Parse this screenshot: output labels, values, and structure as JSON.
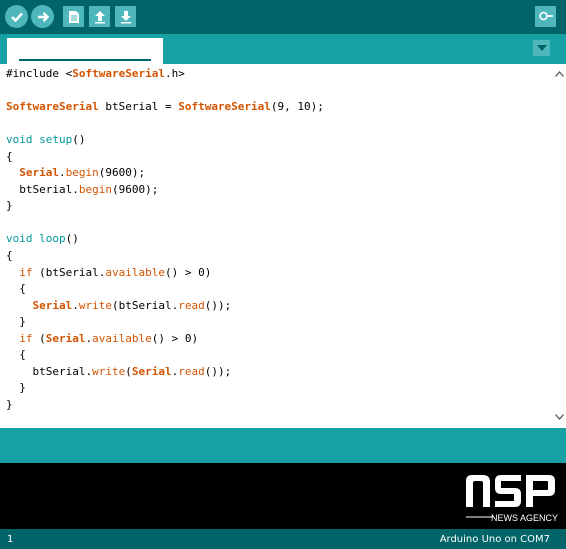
{
  "toolbar": {
    "buttons": [
      {
        "name": "verify",
        "icon": "checkmark-icon"
      },
      {
        "name": "upload",
        "icon": "arrow-right-icon"
      },
      {
        "name": "new",
        "icon": "new-file-icon"
      },
      {
        "name": "open",
        "icon": "arrow-up-icon"
      },
      {
        "name": "save",
        "icon": "arrow-down-icon"
      },
      {
        "name": "serial-monitor",
        "icon": "magnifier-icon"
      }
    ]
  },
  "tab": {
    "label": ""
  },
  "code": {
    "lines": [
      [
        {
          "t": "#include <"
        },
        {
          "t": "SoftwareSerial",
          "c": "class"
        },
        {
          "t": ".h>"
        }
      ],
      [],
      [
        {
          "t": "SoftwareSerial",
          "c": "class"
        },
        {
          "t": " btSerial = "
        },
        {
          "t": "SoftwareSerial",
          "c": "class"
        },
        {
          "t": "(9, 10);"
        }
      ],
      [],
      [
        {
          "t": "void",
          "c": "type"
        },
        {
          "t": " "
        },
        {
          "t": "setup",
          "c": "type"
        },
        {
          "t": "()"
        }
      ],
      [
        {
          "t": "{"
        }
      ],
      [
        {
          "t": "  "
        },
        {
          "t": "Serial",
          "c": "class"
        },
        {
          "t": "."
        },
        {
          "t": "begin",
          "c": "fn"
        },
        {
          "t": "(9600);"
        }
      ],
      [
        {
          "t": "  btSerial."
        },
        {
          "t": "begin",
          "c": "fn"
        },
        {
          "t": "(9600);"
        }
      ],
      [
        {
          "t": "}"
        }
      ],
      [],
      [
        {
          "t": "void",
          "c": "type"
        },
        {
          "t": " "
        },
        {
          "t": "loop",
          "c": "type"
        },
        {
          "t": "()"
        }
      ],
      [
        {
          "t": "{"
        }
      ],
      [
        {
          "t": "  "
        },
        {
          "t": "if",
          "c": "fn"
        },
        {
          "t": " (btSerial."
        },
        {
          "t": "available",
          "c": "fn"
        },
        {
          "t": "() > 0)"
        }
      ],
      [
        {
          "t": "  {"
        }
      ],
      [
        {
          "t": "    "
        },
        {
          "t": "Serial",
          "c": "class"
        },
        {
          "t": "."
        },
        {
          "t": "write",
          "c": "fn"
        },
        {
          "t": "(btSerial."
        },
        {
          "t": "read",
          "c": "fn"
        },
        {
          "t": "());"
        }
      ],
      [
        {
          "t": "  }"
        }
      ],
      [
        {
          "t": "  "
        },
        {
          "t": "if",
          "c": "fn"
        },
        {
          "t": " ("
        },
        {
          "t": "Serial",
          "c": "class"
        },
        {
          "t": "."
        },
        {
          "t": "available",
          "c": "fn"
        },
        {
          "t": "() > 0)"
        }
      ],
      [
        {
          "t": "  {"
        }
      ],
      [
        {
          "t": "    btSerial."
        },
        {
          "t": "write",
          "c": "fn"
        },
        {
          "t": "("
        },
        {
          "t": "Serial",
          "c": "class"
        },
        {
          "t": "."
        },
        {
          "t": "read",
          "c": "fn"
        },
        {
          "t": "());"
        }
      ],
      [
        {
          "t": "  }"
        }
      ],
      [
        {
          "t": "}"
        }
      ]
    ]
  },
  "status": {
    "line": "1",
    "board": "Arduino Uno on COM7"
  },
  "watermark": {
    "logo": "NSP",
    "subtitle": "NEWS AGENCY"
  },
  "colors": {
    "toolbar": "#006468",
    "accent": "#17a1a5",
    "button": "#4db7bb",
    "class": "#d35400",
    "type": "#00979c"
  }
}
